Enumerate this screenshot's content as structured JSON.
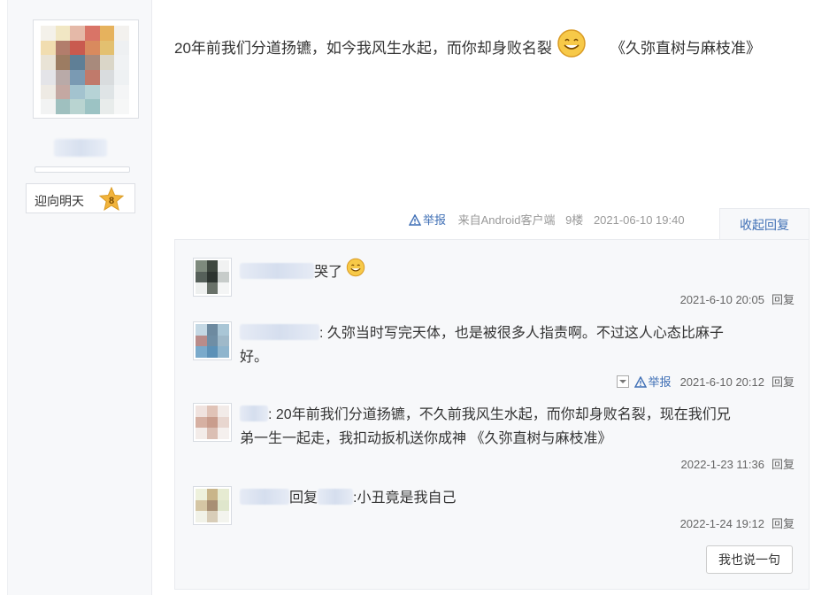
{
  "author": {
    "badge_label": "迎向明天",
    "level": "8"
  },
  "post": {
    "text": "20年前我们分道扬镳，如今我风生水起，而你却身败名裂",
    "tail_text": "《久弥直树与麻枝准》",
    "report_label": "举报",
    "source": "来自Android客户端",
    "floor": "9楼",
    "time": "2021-06-10 19:40",
    "collapse_label": "收起回复"
  },
  "replies": [
    {
      "text": "哭了",
      "time": "2021-6-10 20:05",
      "reply_label": "回复"
    },
    {
      "text_line1": ": 久弥当时写完天体，也是被很多人指责啊。不过这人心态比麻子",
      "text_line2": "好。",
      "report_label": "举报",
      "time": "2021-6-10 20:12",
      "reply_label": "回复"
    },
    {
      "text_line1": ": 20年前我们分道扬镳，不久前我风生水起，而你却身败名裂，现在我们兄",
      "text_line2": "弟一生一起走，我扣动扳机送你成神 《久弥直树与麻枝准》",
      "time": "2022-1-23 11:36",
      "reply_label": "回复"
    },
    {
      "reply_word": "回复",
      "text": ":小丑竟是我自己",
      "time": "2022-1-24 19:12",
      "reply_label": "回复"
    }
  ],
  "say_button": "我也说一句",
  "colors": {
    "link": "#3f6fb5",
    "panel": "#f7f8fa",
    "border": "#e9ebef"
  }
}
